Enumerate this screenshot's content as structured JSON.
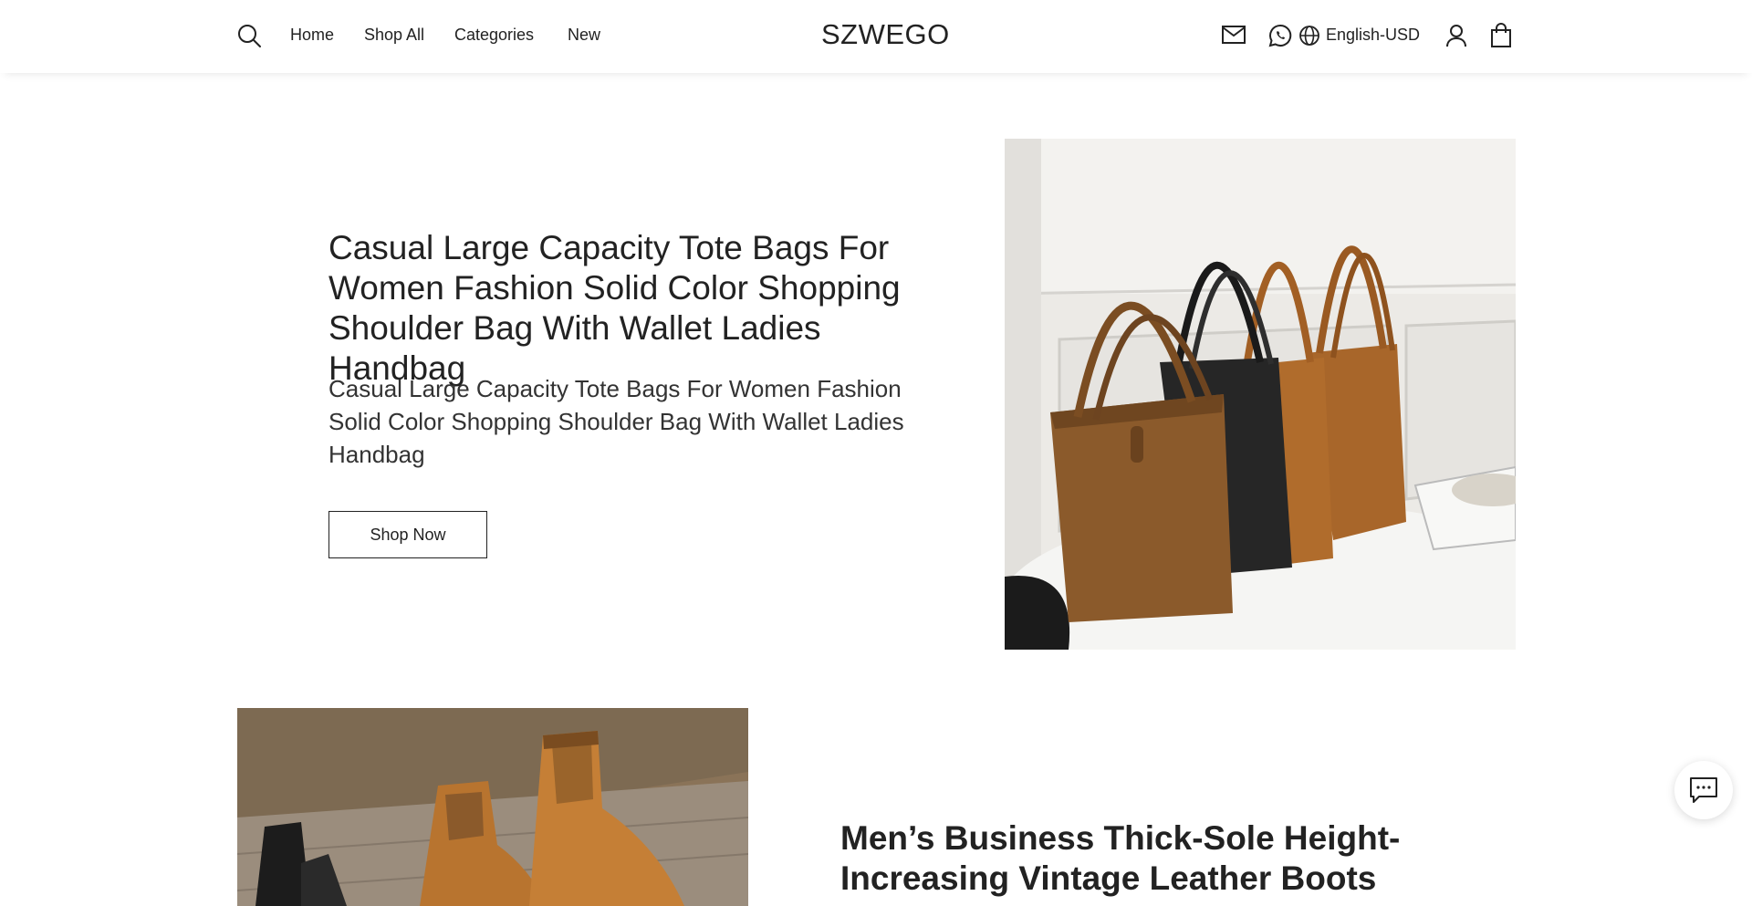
{
  "header": {
    "nav": [
      "Home",
      "Shop All",
      "Categories",
      "New"
    ],
    "logo": "SZWEGO",
    "language_currency": "English-USD"
  },
  "feature1": {
    "title": "Casual Large Capacity Tote Bags For Women Fashion Solid Color Shopping Shoulder Bag With Wallet Ladies Handbag",
    "description": "Casual Large Capacity Tote Bags For Women Fashion Solid Color Shopping Shoulder Bag With Wallet Ladies Handbag",
    "button_label": "Shop Now",
    "image_icon": "tote-bags-photo"
  },
  "feature2": {
    "title": "Men’s Business Thick-Sole Height-Increasing Vintage Leather Boots",
    "image_icon": "leather-boots-photo"
  },
  "icons": {
    "search": "search-icon",
    "mail": "mail-icon",
    "whatsapp": "whatsapp-icon",
    "globe": "globe-icon",
    "user": "user-icon",
    "bag": "shopping-bag-icon",
    "chat": "chat-icon"
  },
  "colors": {
    "text": "#222222",
    "background": "#ffffff"
  }
}
